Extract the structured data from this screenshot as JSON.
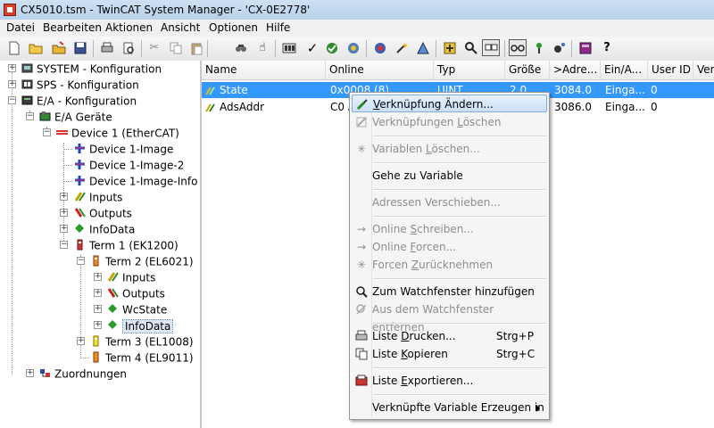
{
  "window": {
    "title": "CX5010.tsm - TwinCAT System Manager - 'CX-0E2778'"
  },
  "menu": [
    "Datei",
    "Bearbeiten",
    "Aktionen",
    "Ansicht",
    "Optionen",
    "Hilfe"
  ],
  "toolbar": {
    "icons": [
      "new-file-icon",
      "open-folder-icon",
      "open-project-icon",
      "save-icon",
      "print-icon",
      "print-preview-icon",
      "cut-icon",
      "copy-icon",
      "paste-icon",
      "find-icon",
      "hand-icon",
      "build-icon",
      "check-icon",
      "activate-config-icon",
      "restart-icon",
      "target-icon",
      "wizard-icon",
      "scan-icon",
      "add-icon",
      "search-icon",
      "toggle-view-icon",
      "glasses-icon",
      "network-icon",
      "config-icon",
      "book-icon",
      "help-icon"
    ]
  },
  "tree": [
    {
      "label": "SYSTEM - Konfiguration"
    },
    {
      "label": "SPS - Konfiguration"
    },
    {
      "label": "E/A - Konfiguration"
    },
    {
      "label": "E/A Geräte"
    },
    {
      "label": "Device 1 (EtherCAT)"
    },
    {
      "label": "Device 1-Image"
    },
    {
      "label": "Device 1-Image-2"
    },
    {
      "label": "Device 1-Image-Info"
    },
    {
      "label": "Inputs"
    },
    {
      "label": "Outputs"
    },
    {
      "label": "InfoData"
    },
    {
      "label": "Term 1 (EK1200)"
    },
    {
      "label": "Term 2 (EL6021)"
    },
    {
      "label": "Inputs"
    },
    {
      "label": "Outputs"
    },
    {
      "label": "WcState"
    },
    {
      "label": "InfoData"
    },
    {
      "label": "Term 3 (EL1008)"
    },
    {
      "label": "Term 4 (EL9011)"
    },
    {
      "label": "Zuordnungen"
    }
  ],
  "list": {
    "columns": [
      "Name",
      "Online",
      "Typ",
      "Größe",
      ">Adre...",
      "Ein/A...",
      "User ID",
      "Verk"
    ],
    "rows": [
      {
        "name": "State",
        "online": "0x0008 (8)",
        "typ": "UINT",
        "groesse": "2.0",
        "adresse": "3084.0",
        "ein_aus": "Einga...",
        "user_id": "0"
      },
      {
        "name": "AdsAddr",
        "online": "C0 A",
        "typ": "",
        "groesse": "",
        "adresse": "3086.0",
        "ein_aus": "Einga...",
        "user_id": "0"
      }
    ]
  },
  "context_menu": {
    "items": [
      {
        "pre": "",
        "u": "V",
        "post": "erknüpfung Ändern...",
        "shortcut": ""
      },
      {
        "pre": "Verknüpfungen ",
        "u": "L",
        "post": "öschen",
        "shortcut": ""
      },
      {
        "pre": "Variablen ",
        "u": "L",
        "post": "öschen...",
        "shortcut": ""
      },
      {
        "pre": "Gehe zu Variable",
        "u": "",
        "post": "",
        "shortcut": ""
      },
      {
        "pre": "Adressen Verschieben...",
        "u": "",
        "post": "",
        "shortcut": ""
      },
      {
        "pre": "Online ",
        "u": "S",
        "post": "chreiben...",
        "shortcut": ""
      },
      {
        "pre": "Online ",
        "u": "F",
        "post": "orcen...",
        "shortcut": ""
      },
      {
        "pre": "Forcen ",
        "u": "Z",
        "post": "urücknehmen",
        "shortcut": ""
      },
      {
        "pre": "Zum Watchfenster hinzufügen",
        "u": "",
        "post": "",
        "shortcut": ""
      },
      {
        "pre": "Aus dem Watchfenster entfernen",
        "u": "",
        "post": "",
        "shortcut": ""
      },
      {
        "pre": "Liste ",
        "u": "D",
        "post": "rucken...",
        "shortcut": "Strg+P"
      },
      {
        "pre": "Liste ",
        "u": "K",
        "post": "opieren",
        "shortcut": "Strg+C"
      },
      {
        "pre": "Liste ",
        "u": "E",
        "post": "xportieren...",
        "shortcut": ""
      },
      {
        "pre": "Verknüpfte Variable Erzeugen in",
        "u": "",
        "post": "",
        "shortcut": ""
      }
    ]
  }
}
